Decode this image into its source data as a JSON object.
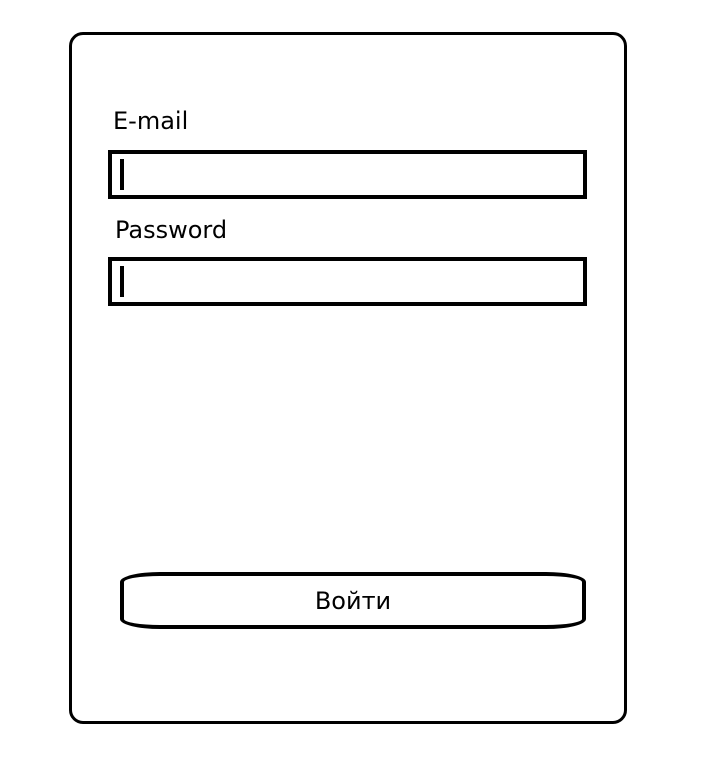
{
  "form": {
    "email_label": "E-mail",
    "email_value": "",
    "password_label": "Password",
    "password_value": "",
    "submit_label": "Войти"
  },
  "colors": {
    "stroke": "#000000",
    "background": "#ffffff"
  }
}
